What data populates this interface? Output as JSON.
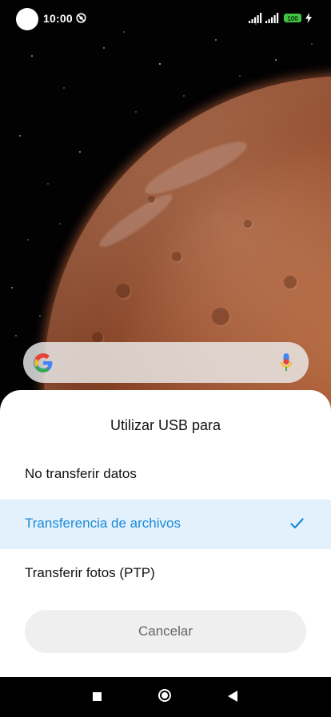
{
  "status_bar": {
    "time": "10:00",
    "battery_level": "100",
    "icons": [
      "do-not-disturb-icon",
      "signal-icon",
      "signal-icon",
      "battery-icon",
      "charging-icon"
    ]
  },
  "search_bar": {
    "icons": [
      "google-logo-icon",
      "microphone-icon"
    ]
  },
  "usb_dialog": {
    "title": "Utilizar USB para",
    "options": [
      {
        "label": "No transferir datos",
        "selected": false
      },
      {
        "label": "Transferencia de archivos",
        "selected": true
      },
      {
        "label": "Transferir fotos (PTP)",
        "selected": false
      }
    ],
    "cancel_label": "Cancelar"
  },
  "colors": {
    "selected_text": "#1a8ad8",
    "selected_background": "#e3f1fd",
    "battery": "#3ec63e"
  },
  "nav_bar": {
    "icons": [
      "recents-icon",
      "home-icon",
      "back-icon"
    ]
  }
}
